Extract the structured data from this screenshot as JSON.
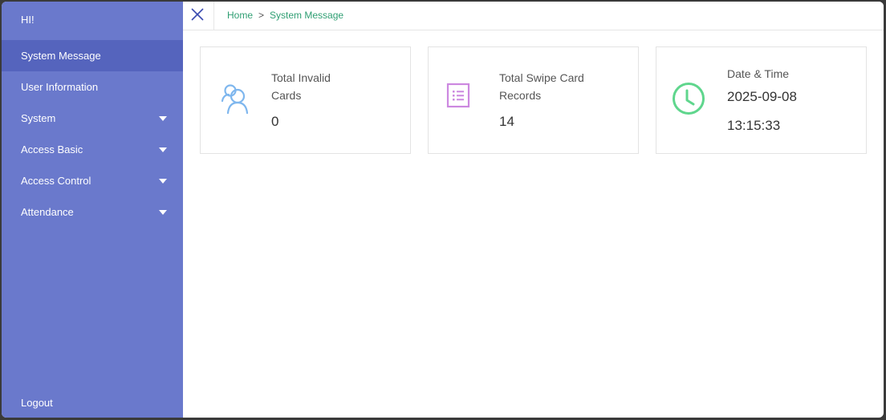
{
  "sidebar": {
    "greeting": "HI!",
    "items": [
      {
        "label": "System Message"
      },
      {
        "label": "User Information"
      },
      {
        "label": "System"
      },
      {
        "label": "Access Basic"
      },
      {
        "label": "Access Control"
      },
      {
        "label": "Attendance"
      }
    ],
    "logout": "Logout"
  },
  "breadcrumb": {
    "home": "Home",
    "separator": ">",
    "current": "System Message"
  },
  "cards": [
    {
      "title_line1": "Total Invalid",
      "title_line2": "Cards",
      "value": "0",
      "icon": "users-icon"
    },
    {
      "title_line1": "Total Swipe Card",
      "title_line2": "Records",
      "value": "14",
      "icon": "list-icon"
    },
    {
      "title": "Date & Time",
      "date": "2025-09-08",
      "time": "13:15:33",
      "icon": "clock-icon"
    }
  ],
  "colors": {
    "sidebar_bg": "#6a79cc",
    "sidebar_active": "#5564bd",
    "breadcrumb": "#2e9e72",
    "users_icon": "#7fb7ee",
    "list_icon": "#cc88e0",
    "clock_icon": "#5fd68d"
  }
}
